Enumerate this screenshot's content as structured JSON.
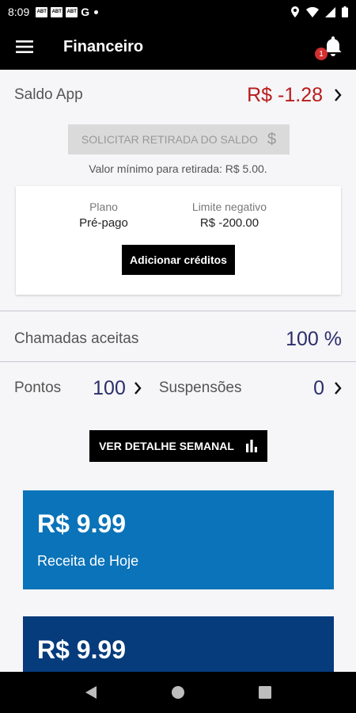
{
  "status_bar": {
    "time": "8:09",
    "notification_icons": [
      "ABT",
      "ABT",
      "ABT"
    ],
    "extra_icon": "G",
    "indicators": [
      "location-icon",
      "wifi-icon",
      "signal-icon",
      "battery-icon"
    ]
  },
  "app_bar": {
    "title": "Financeiro",
    "notification_count": "1"
  },
  "balance": {
    "label": "Saldo App",
    "value": "R$ -1.28",
    "value_color": "#b71c1c"
  },
  "withdraw": {
    "button_label": "SOLICITAR RETIRADA DO SALDO",
    "icon": "$",
    "min_text": "Valor mínimo para retirada: R$ 5.00."
  },
  "plan_card": {
    "plan_label": "Plano",
    "plan_value": "Pré-pago",
    "limit_label": "Limite negativo",
    "limit_value": "R$ -200.00",
    "add_credits_label": "Adicionar créditos"
  },
  "calls": {
    "label": "Chamadas aceitas",
    "value": "100 %"
  },
  "stats": {
    "points_label": "Pontos",
    "points_value": "100",
    "suspensions_label": "Suspensões",
    "suspensions_value": "0"
  },
  "weekly_button": {
    "label": "VER DETALHE SEMANAL"
  },
  "revenue_cards": {
    "today": {
      "amount": "R$ 9.99",
      "label": "Receita de Hoje",
      "color": "#0a73b9"
    },
    "second": {
      "amount": "R$ 9.99",
      "color": "#063b7c"
    }
  },
  "colors": {
    "accent_value": "#2a2f6b",
    "badge": "#d32f2f"
  }
}
